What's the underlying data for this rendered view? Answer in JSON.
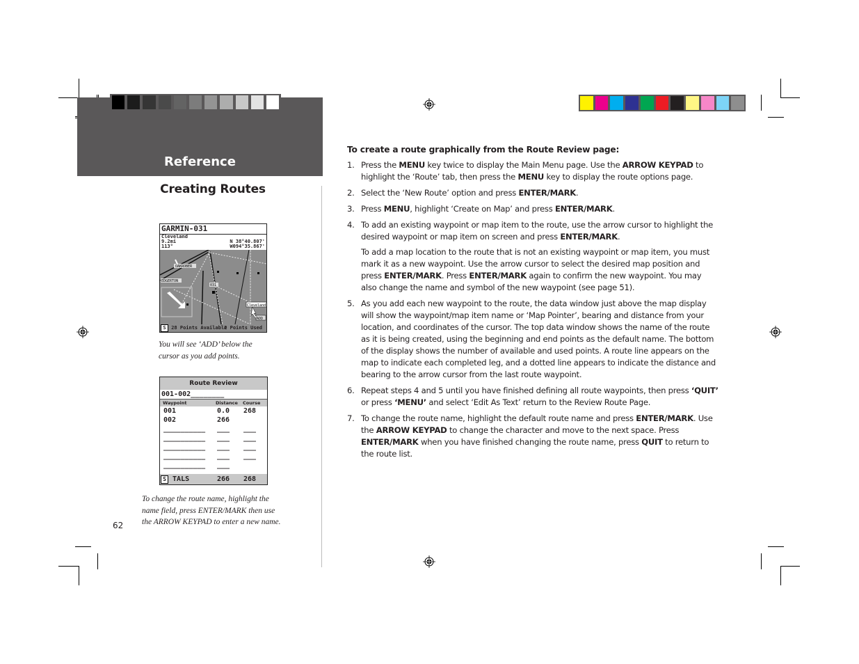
{
  "header": {
    "section": "Reference",
    "title": "Creating Routes"
  },
  "registration_colors": {
    "grayscale": [
      "#000000",
      "#1c1c1c",
      "#353535",
      "#4a4a4a",
      "#636363",
      "#7c7c7c",
      "#949494",
      "#adadad",
      "#c8c8c8",
      "#e3e3e3",
      "#ffffff"
    ],
    "process": [
      "#fff200",
      "#ec008c",
      "#00aeef",
      "#2e3192",
      "#00a651",
      "#ed1c24",
      "#231f20",
      "#fff685",
      "#f787c8",
      "#7dd4f7",
      "#8e8e8e"
    ]
  },
  "map_screen": {
    "title": "GARMIN-031",
    "waypoint_name": "Cleveland",
    "distance": "9.2mi",
    "bearing": "113°",
    "latitude": "N 38°40.807'",
    "longitude": "W094°35.867'",
    "map_labels": [
      "OAKROBER",
      "EDGERTON",
      "031",
      "Cleveland",
      "ADD"
    ],
    "status_icon": "S",
    "points_available": "28 Points Available",
    "points_used": "2 Points Used"
  },
  "map_caption": "You will see ‘ADD’ below the cursor as you add points.",
  "route_screen": {
    "title": "Route Review",
    "route_name": "001-002________",
    "columns": [
      "Waypoint",
      "Distance",
      "Course"
    ],
    "rows": [
      {
        "waypoint": "001",
        "distance": "0.0",
        "course": "268"
      },
      {
        "waypoint": "002",
        "distance": "266",
        "course": ""
      },
      {
        "waypoint": "__________",
        "distance": "___",
        "course": "___"
      },
      {
        "waypoint": "__________",
        "distance": "___",
        "course": "___"
      },
      {
        "waypoint": "__________",
        "distance": "___",
        "course": "___"
      },
      {
        "waypoint": "__________",
        "distance": "___",
        "course": "___"
      },
      {
        "waypoint": "__________",
        "distance": "___",
        "course": ""
      }
    ],
    "totals_label": "TALS",
    "totals_distance": "266",
    "totals_course": "268",
    "status_icon": "S"
  },
  "route_caption": "To change the route name, highlight the name field, press ENTER/MARK then use the ARROW KEYPAD to enter a new name.",
  "page_number": "62",
  "instructions": {
    "heading": "To create a route graphically from the Route Review page:",
    "steps": [
      {
        "num": "1.",
        "html": "Press the <b>MENU</b> key twice to display the Main Menu page. Use the <b>ARROW KEYPAD</b> to highlight the ‘Route’ tab, then press the <b>MENU</b> key to display the route options page."
      },
      {
        "num": "2.",
        "html": "Select the ‘New Route’ option and press <b>ENTER/MARK</b>."
      },
      {
        "num": "3.",
        "html": "Press <b>MENU</b>, highlight ‘Create on Map’ and press <b>ENTER/MARK</b>."
      },
      {
        "num": "4.",
        "html": "To add an existing waypoint or map item to the route, use the arrow cursor to highlight the desired waypoint or map item on screen and press <b>ENTER/MARK</b>.",
        "sub": "To add a map location to the route that is not an existing waypoint or map item, you must mark it as a new waypoint. Use the arrow cursor to select the desired map position and press <b>ENTER/MARK</b>. Press <b>ENTER/MARK</b> again to confirm the new waypoint. You may also change the name and symbol of the new waypoint (see page 51)."
      },
      {
        "num": "5.",
        "html": "As you add each new waypoint to the route, the data window just above the map display will show the waypoint/map item name or ‘Map Pointer’, bearing and distance from your location, and coordinates of the cursor. The top data window shows the name of the route as it is being created, using the beginning and end points as the default name. The bottom of the display shows the number of available and used points. A route line appears on the map to indicate each completed leg, and a dotted line appears to indicate the distance and bearing to the arrow cursor from the last route waypoint."
      },
      {
        "num": "6.",
        "html": "Repeat steps 4 and 5 until you have finished defining all route waypoints, then press <b>‘QUIT’</b> or press <b>‘MENU’</b> and select ‘Edit As Text’ return to the Review Route Page."
      },
      {
        "num": "7.",
        "html": "To change the route name, highlight the default route name and press <b>ENTER/MARK</b>. Use the <b>ARROW KEYPAD</b> to change the character and move to the next space. Press <b>ENTER/MARK</b> when you have finished changing the route name, press <b>QUIT</b> to return to the route list."
      }
    ]
  }
}
